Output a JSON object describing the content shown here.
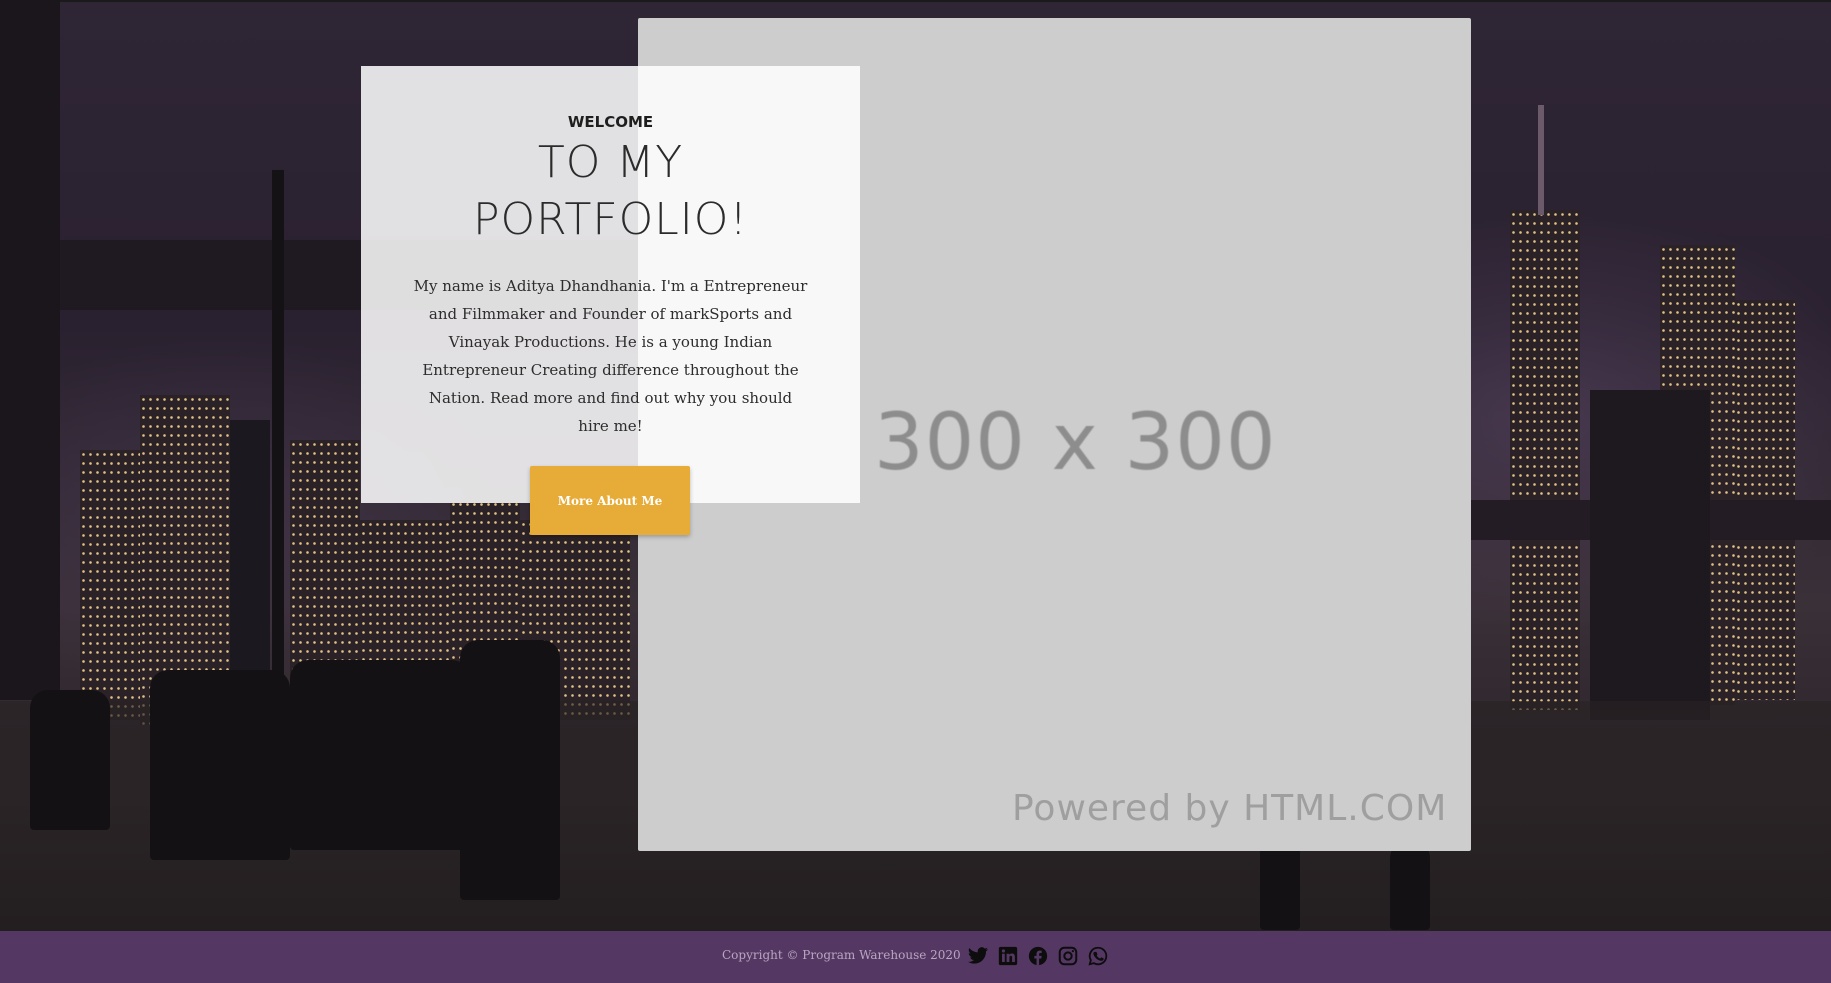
{
  "hero": {
    "eyebrow": "WELCOME",
    "title_line1": "TO MY",
    "title_line2": "PORTFOLIO!",
    "bio": "My name is Aditya Dhandhania. I'm a Entrepreneur and Filmmaker and Founder of markSports and Vinayak Productions. He is a young Indian Entrepreneur Creating difference throughout the Nation. Read more and find out why you should hire me!",
    "button_label": "More About Me"
  },
  "placeholder": {
    "dimensions": "300 x 300",
    "powered_by": "Powered by HTML.COM"
  },
  "footer": {
    "copyright": "Copyright © Program Warehouse 2020",
    "social_icons": [
      "twitter-icon",
      "linkedin-icon",
      "facebook-icon",
      "instagram-icon",
      "whatsapp-icon"
    ]
  },
  "colors": {
    "button": "#e7ab38",
    "footer": "#553763",
    "placeholder": "#cdcdcd"
  }
}
